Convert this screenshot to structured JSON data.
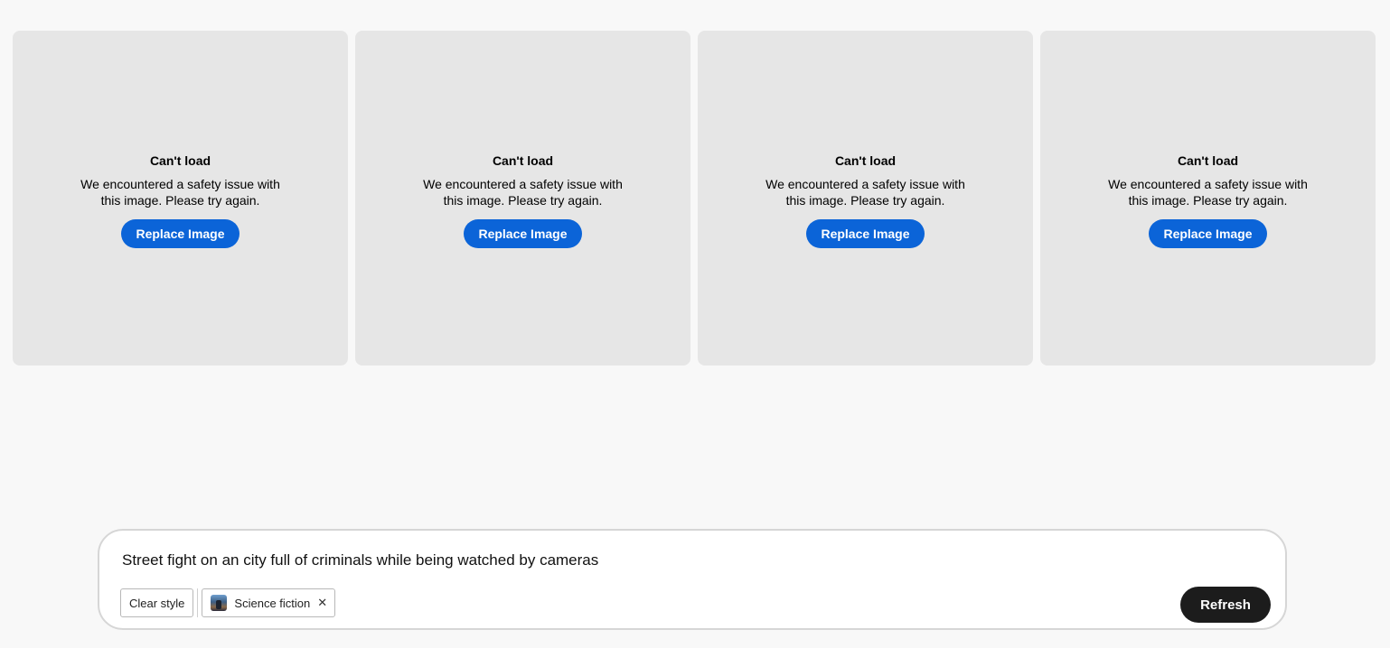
{
  "cards": [
    {
      "title": "Can't load",
      "message": "We encountered a safety issue with this image. Please try again.",
      "button": "Replace Image"
    },
    {
      "title": "Can't load",
      "message": "We encountered a safety issue with this image. Please try again.",
      "button": "Replace Image"
    },
    {
      "title": "Can't load",
      "message": "We encountered a safety issue with this image. Please try again.",
      "button": "Replace Image"
    },
    {
      "title": "Can't load",
      "message": "We encountered a safety issue with this image. Please try again.",
      "button": "Replace Image"
    }
  ],
  "prompt": {
    "text": "Street fight on an city full of criminals while being watched by cameras",
    "clear_style_label": "Clear style",
    "style_chip": {
      "label": "Science fiction",
      "icon": "style-thumbnail-icon",
      "close_icon": "close-icon"
    },
    "refresh_label": "Refresh"
  },
  "colors": {
    "page_bg": "#f8f8f8",
    "card_bg": "#e6e6e6",
    "accent_blue": "#0b64d8",
    "refresh_bg": "#1c1c1c"
  }
}
